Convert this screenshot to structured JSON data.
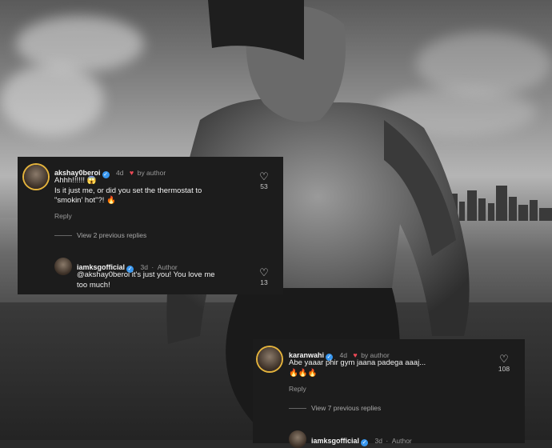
{
  "comment1": {
    "username": "akshay0beroi",
    "time": "4d",
    "by_author": "by author",
    "text_line1": "Ahhh!!!!!! 😱",
    "text_line2": "Is it just me, or did you set the thermostat to",
    "text_line3": "\"smokin' hot\"?! 🔥",
    "reply_label": "Reply",
    "like_count": "53",
    "view_replies": "View 2 previous replies"
  },
  "reply1": {
    "username": "iamksgofficial",
    "time": "3d",
    "author_label": "Author",
    "text_line1": "@akshay0beroi it's just you! You love me",
    "text_line2": "too much!",
    "like_count": "13"
  },
  "comment2": {
    "username": "karanwahi",
    "time": "4d",
    "by_author": "by author",
    "text_line1": "Abe yaaar phir gym jaana padega aaaj...",
    "text_line2": "🔥🔥🔥",
    "reply_label": "Reply",
    "like_count": "108",
    "view_replies": "View 7 previous replies"
  },
  "reply2": {
    "username": "iamksgofficial",
    "time": "3d",
    "author_label": "Author"
  },
  "icons": {
    "verified": "verified-badge-icon",
    "heart": "heart-outline-icon",
    "liked": "red-heart-icon"
  },
  "colors": {
    "card_bg": "#1c1c1c",
    "verified_blue": "#3897f0",
    "heart_red": "#ed4956"
  }
}
